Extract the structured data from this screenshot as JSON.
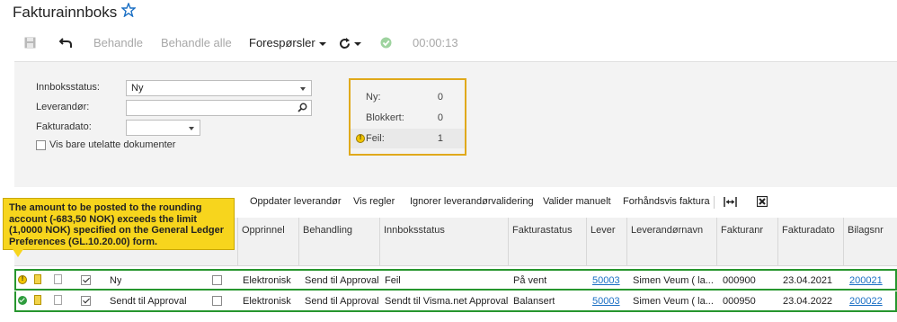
{
  "header": {
    "title": "Fakturainnboks",
    "favorite_icon": "star-outline-icon"
  },
  "toolbar": {
    "save_icon": "save-icon",
    "undo_icon": "undo-icon",
    "process_label": "Behandle",
    "process_all_label": "Behandle alle",
    "requests_label": "Forespørsler",
    "refresh_icon": "refresh-icon",
    "status_icon": "check-circle-icon",
    "timer": "00:00:13"
  },
  "filters": {
    "inbox_status_label": "Innboksstatus:",
    "inbox_status_value": "Ny",
    "supplier_label": "Leverandør:",
    "supplier_value": "",
    "invoice_date_label": "Fakturadato:",
    "invoice_date_value": "",
    "skip_docs_label": "Vis bare utelatte dokumenter",
    "skip_docs_checked": false
  },
  "summary": {
    "new_label": "Ny:",
    "new_count": "0",
    "blocked_label": "Blokkert:",
    "blocked_count": "0",
    "error_label": "Feil:",
    "error_count": "1"
  },
  "grid_toolbar": {
    "update_supplier": "Oppdater leverandør",
    "show_rules": "Vis regler",
    "ignore_validation": "Ignorer leverandørvalidering",
    "validate_manual": "Valider manuelt",
    "preview_invoice": "Forhåndsvis faktura",
    "fit_icon": "fit-columns-icon",
    "excel_icon": "excel-export-icon"
  },
  "columns": [
    "Opprinnel",
    "Behandling",
    "Innboksstatus",
    "Fakturastatus",
    "Lever",
    "Leverandørnavn",
    "Fakturanr",
    "Fakturadato",
    "Bilagsnr"
  ],
  "rows": [
    {
      "status_icon": "warning-icon",
      "selected": true,
      "inbox_status": "Ny",
      "origin": "Elektronisk",
      "processing": "Send til Approval",
      "inbox_status_col": "Feil",
      "invoice_status": "På vent",
      "supplier_id": "50003",
      "supplier_name": "Simen Veum ( la...",
      "invoice_no": "000900",
      "invoice_date": "23.04.2021",
      "voucher_no": "200021"
    },
    {
      "status_icon": "ok-icon",
      "selected": true,
      "inbox_status": "Sendt til Approval",
      "origin": "Elektronisk",
      "processing": "Send til Approval",
      "inbox_status_col": "Sendt til Visma.net Approval",
      "invoice_status": "Balansert",
      "supplier_id": "50003",
      "supplier_name": "Simen Veum ( la...",
      "invoice_no": "000950",
      "invoice_date": "23.04.2022",
      "voucher_no": "200022"
    }
  ],
  "tooltip": {
    "text": "The amount to be posted to the rounding account (-683,50 NOK) exceeds the limit (1,0000 NOK) specified on the General Ledger Preferences (GL.10.20.00) form."
  },
  "colors": {
    "warning": "#f7d51d",
    "success": "#27962e",
    "link": "#1a6fc4",
    "accent_border": "#e0a91b"
  }
}
